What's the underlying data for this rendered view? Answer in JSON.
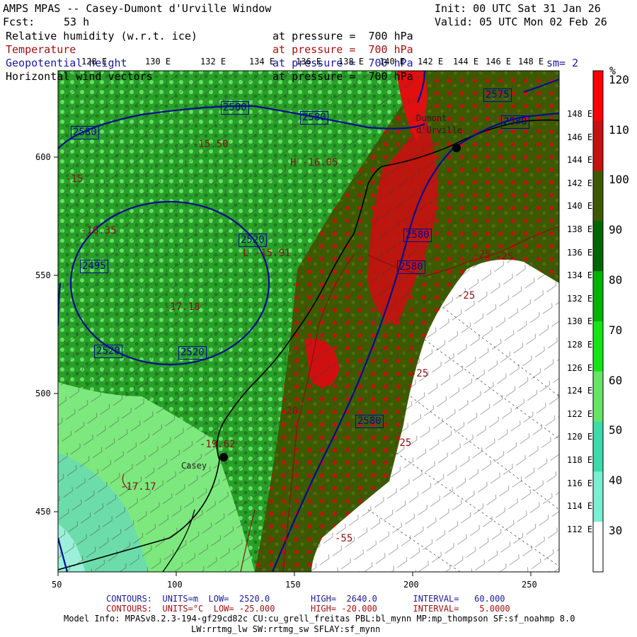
{
  "header": {
    "title": "AMPS MPAS -- Casey-Dumont d'Urville Window",
    "fcst_label": "Fcst:",
    "fcst_value": "53 h",
    "init": "Init: 00 UTC Sat 31 Jan 26",
    "valid": "Valid: 05 UTC Mon 02 Feb 26"
  },
  "fields": [
    {
      "name": "Relative humidity (w.r.t. ice)",
      "level": "at pressure =  700 hPa"
    },
    {
      "name": "Temperature",
      "level": "at pressure =  700 hPa"
    },
    {
      "name": "Geopotential height",
      "level": "at pressure =  700 hPa"
    },
    {
      "name": "Horizontal wind vectors",
      "level": "at pressure =  700 hPa"
    }
  ],
  "smoothing": "sm= 2",
  "lon_labels": [
    "128 E",
    "130 E",
    "132 E",
    "134 E",
    "136 E",
    "138 E",
    "140 E",
    "142 E",
    "144 E",
    "146 E",
    "148 E"
  ],
  "lat_labels": [
    "148 E",
    "146 E",
    "144 E",
    "142 E",
    "140 E",
    "138 E",
    "136 E",
    "134 E",
    "132 E",
    "130 E",
    "128 E",
    "126 E",
    "124 E",
    "122 E",
    "120 E",
    "118 E",
    "116 E",
    "114 E",
    "112 E"
  ],
  "x_ticks": [
    "50",
    "100",
    "150",
    "200",
    "250"
  ],
  "y_ticks": [
    "600",
    "550",
    "500",
    "450"
  ],
  "colorbar": {
    "unit": "%",
    "labels": [
      "120",
      "110",
      "100",
      "90",
      "80",
      "70",
      "60",
      "50",
      "40",
      "30"
    ],
    "colors": [
      "#ff0000",
      "#c81010",
      "#3d5a00",
      "#006600",
      "#00b400",
      "#14e614",
      "#64e664",
      "#3cdcaa",
      "#78f0d2",
      "#ffffff"
    ]
  },
  "places": [
    {
      "name": "Dumont d'Urville",
      "lines": [
        "Dumont",
        "d'Urville"
      ]
    },
    {
      "name": "Casey"
    }
  ],
  "height_contours": [
    "2580",
    "2580",
    "2580",
    "2575",
    "2580",
    "2520",
    "2495",
    "2520",
    "2520",
    "2580",
    "2580",
    "2580"
  ],
  "temp_contours": [
    "-25",
    "-25",
    "-20",
    "-25",
    "-25",
    "-55",
    "-25"
  ],
  "extrema": [
    {
      "label": "H",
      "value": "-16.05"
    },
    {
      "label": "L",
      "value": "-15.91"
    },
    {
      "label": "",
      "value": "-17.18"
    },
    {
      "label": "",
      "value": "-19.62"
    },
    {
      "label": "",
      "value": "-17.17"
    },
    {
      "label": "",
      "value": "-15.50"
    },
    {
      "label": "",
      "value": "-15"
    },
    {
      "label": "",
      "value": "-16.35"
    }
  ],
  "footer": {
    "contours_m": "CONTOURS:  UNITS=m  LOW=  2520.0        HIGH=  2640.0       INTERVAL=   60.000",
    "contours_c": "CONTOURS:  UNITS=°C  LOW= -25.000       HIGH= -20.000       INTERVAL=    5.0000",
    "model_info": "Model Info: MPASv8.2.3-194-gf29cd82c CU:cu_grell_freitas PBL:bl_mynn MP:mp_thompson SF:sf_noahmp 8.0",
    "model_info2": "LW:rrtmg_lw SW:rrtmg_sw SFLAY:sf_mynn"
  }
}
